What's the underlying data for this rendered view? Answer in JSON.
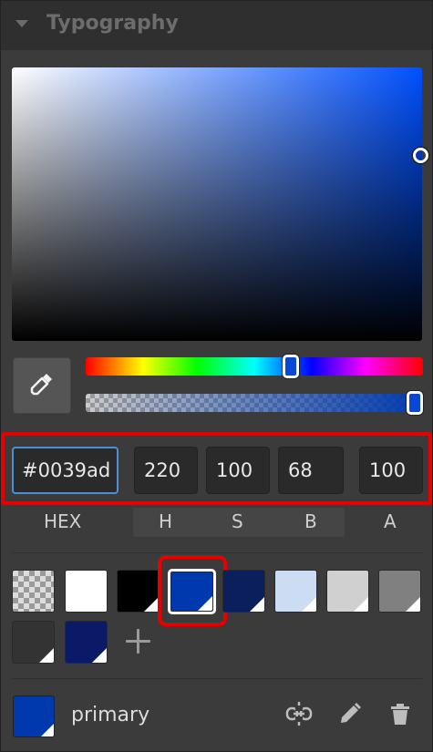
{
  "section": {
    "title": "Typography"
  },
  "picker": {
    "current_color": "#0039ad",
    "hue": 220,
    "saturation": 100,
    "brightness": 68,
    "alpha": 100
  },
  "fields": {
    "hex": "#0039ad",
    "h": "220",
    "s": "100",
    "b": "68",
    "a": "100"
  },
  "labels": {
    "hex": "HEX",
    "h": "H",
    "s": "S",
    "b": "B",
    "a": "A"
  },
  "swatches": [
    {
      "name": "transparent",
      "color": "transparent"
    },
    {
      "name": "white",
      "color": "#ffffff"
    },
    {
      "name": "black",
      "color": "#000000"
    },
    {
      "name": "primary-blue",
      "color": "#0039ad",
      "selected": true
    },
    {
      "name": "navy",
      "color": "#0a1f5c"
    },
    {
      "name": "light-blue",
      "color": "#ccdcf2"
    },
    {
      "name": "light-gray",
      "color": "#d0d0d0"
    },
    {
      "name": "gray",
      "color": "#808080"
    },
    {
      "name": "dark-gray",
      "color": "#333333"
    },
    {
      "name": "dark-navy",
      "color": "#0b1a66"
    }
  ],
  "current_swatch": {
    "name": "primary",
    "color": "#0039ad"
  },
  "icons": {
    "collapse": "caret-down-icon",
    "eyedropper": "eyedropper-icon",
    "add": "plus-icon",
    "unlink": "unlink-icon",
    "edit": "pencil-icon",
    "delete": "trash-icon"
  },
  "colors": {
    "highlight": "#e60000",
    "focus": "#4a90d9",
    "panel": "#3b3b3b"
  }
}
